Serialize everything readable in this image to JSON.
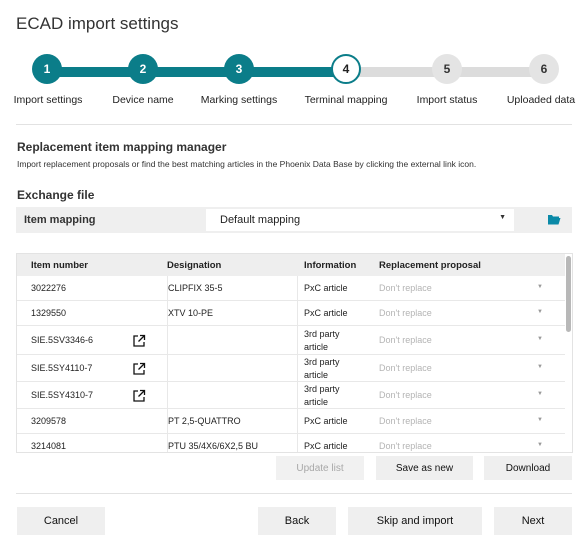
{
  "dialog": {
    "title": "ECAD import settings"
  },
  "stepper": {
    "steps": [
      {
        "number": "1",
        "label": "Import settings",
        "state": "done"
      },
      {
        "number": "2",
        "label": "Device name",
        "state": "done"
      },
      {
        "number": "3",
        "label": "Marking settings",
        "state": "done"
      },
      {
        "number": "4",
        "label": "Terminal mapping",
        "state": "active"
      },
      {
        "number": "5",
        "label": "Import status",
        "state": "todo"
      },
      {
        "number": "6",
        "label": "Uploaded data",
        "state": "todo"
      }
    ],
    "colors": {
      "done": "#0b7d89",
      "todo": "#dcdcdc"
    }
  },
  "section": {
    "title": "Replacement item mapping manager",
    "description": "Import replacement proposals or find the best matching articles in the Phoenix Data Base by clicking the external link icon."
  },
  "exchange": {
    "title": "Exchange file",
    "mapping_label": "Item mapping",
    "mapping_value": "Default mapping",
    "folder_icon": "folder-open-icon"
  },
  "table": {
    "headers": {
      "item_number": "Item number",
      "designation": "Designation",
      "information": "Information",
      "replacement": "Replacement proposal"
    },
    "rows": [
      {
        "item_number": "3022276",
        "external": false,
        "designation": "CLIPFIX 35-5",
        "info_line1": "PxC article",
        "info_line2": "",
        "replacement": "Don't replace"
      },
      {
        "item_number": "1329550",
        "external": false,
        "designation": "XTV 10-PE",
        "info_line1": "PxC article",
        "info_line2": "",
        "replacement": "Don't replace"
      },
      {
        "item_number": "SIE.5SV3346-6",
        "external": true,
        "designation": "",
        "info_line1": "3rd party",
        "info_line2": "article",
        "replacement": "Don't replace"
      },
      {
        "item_number": "SIE.5SY4110-7",
        "external": true,
        "designation": "",
        "info_line1": "3rd party",
        "info_line2": "article",
        "replacement": "Don't replace"
      },
      {
        "item_number": "SIE.5SY4310-7",
        "external": true,
        "designation": "",
        "info_line1": "3rd party",
        "info_line2": "article",
        "replacement": "Don't replace"
      },
      {
        "item_number": "3209578",
        "external": false,
        "designation": "PT 2,5-QUATTRO",
        "info_line1": "PxC article",
        "info_line2": "",
        "replacement": "Don't replace"
      },
      {
        "item_number": "3214081",
        "external": false,
        "designation": "PTU 35/4X6/6X2,5 BU",
        "info_line1": "PxC article",
        "info_line2": "",
        "replacement": "Don't replace"
      }
    ]
  },
  "table_actions": {
    "update_list": "Update list",
    "save_as_new": "Save as new",
    "download": "Download"
  },
  "footer": {
    "cancel": "Cancel",
    "back": "Back",
    "skip_and_import": "Skip and import",
    "next": "Next"
  }
}
